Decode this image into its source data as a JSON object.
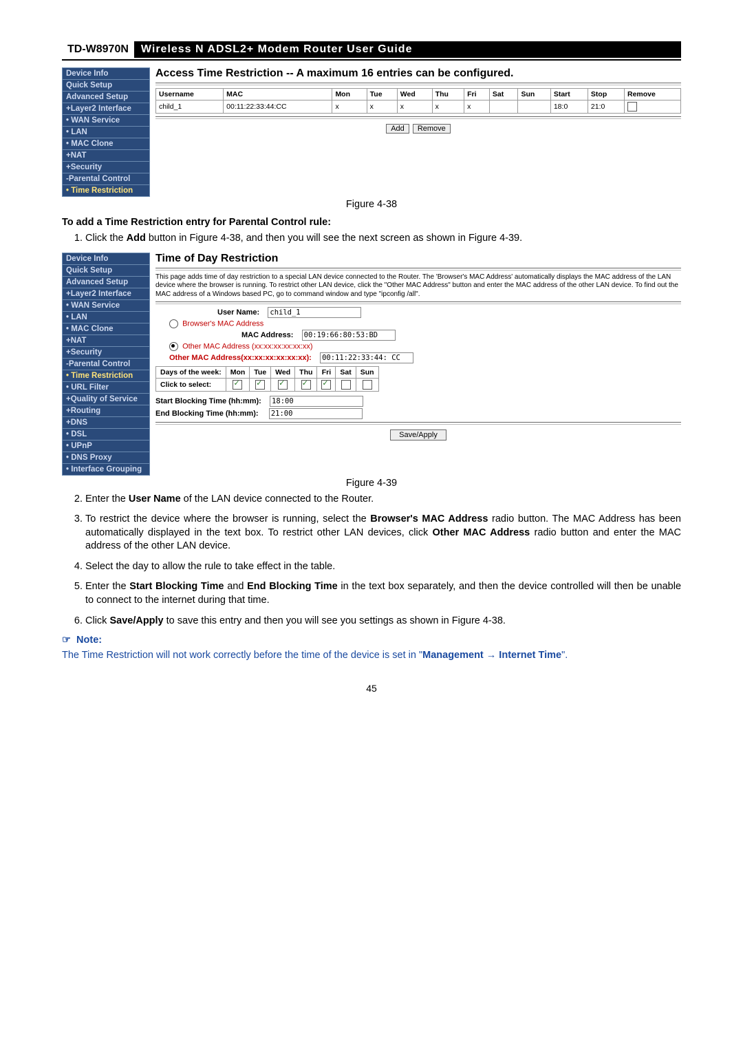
{
  "header": {
    "model": "TD-W8970N",
    "title": "Wireless N ADSL2+ Modem Router User Guide"
  },
  "fig38": {
    "caption": "Figure 4-38",
    "title": "Access Time Restriction -- A maximum 16 entries can be configured.",
    "sidebar": [
      "Device Info",
      "Quick Setup",
      "Advanced Setup",
      "+Layer2 Interface",
      "• WAN Service",
      "• LAN",
      "• MAC Clone",
      "+NAT",
      "+Security",
      "-Parental Control",
      "• Time Restriction"
    ],
    "table": {
      "headers": [
        "Username",
        "MAC",
        "Mon",
        "Tue",
        "Wed",
        "Thu",
        "Fri",
        "Sat",
        "Sun",
        "Start",
        "Stop",
        "Remove"
      ],
      "row": {
        "user": "child_1",
        "mac": "00:11:22:33:44:CC",
        "mon": "x",
        "tue": "x",
        "wed": "x",
        "thu": "x",
        "fri": "x",
        "sat": "",
        "sun": "",
        "start": "18:0",
        "stop": "21:0"
      }
    },
    "btn_add": "Add",
    "btn_remove": "Remove"
  },
  "subhead1": "To add a Time Restriction entry for Parental Control rule:",
  "step1_pre": "Click the ",
  "step1_bold": "Add",
  "step1_post": " button in Figure 4-38, and then you will see the next screen as shown in Figure 4-39.",
  "fig39": {
    "caption": "Figure 4-39",
    "title": "Time of Day Restriction",
    "intro": "This page adds time of day restriction to a special LAN device connected to the Router. The 'Browser's MAC Address' automatically displays the MAC address of the LAN device where the browser is running. To restrict other LAN device, click the \"Other MAC Address\" button and enter the MAC address of the other LAN device. To find out the MAC address of a Windows based PC, go to command window and type \"ipconfig /all\".",
    "sidebar": [
      "Device Info",
      "Quick Setup",
      "Advanced Setup",
      "+Layer2 Interface",
      "• WAN Service",
      "• LAN",
      "• MAC Clone",
      "+NAT",
      "+Security",
      "-Parental Control",
      "• Time Restriction",
      "• URL Filter",
      "+Quality of Service",
      "+Routing",
      "+DNS",
      "• DSL",
      "• UPnP",
      "• DNS Proxy",
      "• Interface Grouping"
    ],
    "labels": {
      "username": "User Name:",
      "username_val": "child_1",
      "browser_mac": "Browser's MAC Address",
      "mac_address": "MAC Address:",
      "mac_val": "00:19:66:80:53:BD",
      "other_mac": "Other MAC Address (xx:xx:xx:xx:xx:xx)",
      "other_mac_label": "Other MAC Address(xx:xx:xx:xx:xx:xx):",
      "other_mac_val": "00:11:22:33:44: CC",
      "days_label": "Days of the week:",
      "click_select": "Click to select:",
      "days": [
        "Mon",
        "Tue",
        "Wed",
        "Thu",
        "Fri",
        "Sat",
        "Sun"
      ],
      "start_label": "Start Blocking Time (hh:mm):",
      "start_val": "18:00",
      "end_label": "End Blocking Time (hh:mm):",
      "end_val": "21:00",
      "save_btn": "Save/Apply"
    }
  },
  "step2_pre": "Enter the ",
  "step2_bold": "User Name",
  "step2_post": " of the LAN device connected to the Router.",
  "step3_a": "To restrict the device where the browser is running, select the ",
  "step3_b": "Browser's MAC Address",
  "step3_c": " radio button. The MAC Address has been automatically displayed in the text box. To restrict other LAN devices, click ",
  "step3_d": "Other MAC Address",
  "step3_e": " radio button and enter the MAC address of the other LAN device.",
  "step4": "Select the day to allow the rule to take effect in the table.",
  "step5_a": "Enter the ",
  "step5_b": "Start Blocking Time",
  "step5_c": " and ",
  "step5_d": "End Blocking Time",
  "step5_e": " in the text box separately, and then the device controlled will then be unable to connect to the internet during that time.",
  "step6_a": "Click ",
  "step6_b": "Save/Apply",
  "step6_c": " to save this entry and then you will see you settings as shown in Figure 4-38.",
  "note_label": "Note:",
  "note_a": "The Time Restriction will not work correctly before the time of the device is set in \"",
  "note_b": "Management → Internet Time",
  "note_c": "\".",
  "pagenum": "45"
}
